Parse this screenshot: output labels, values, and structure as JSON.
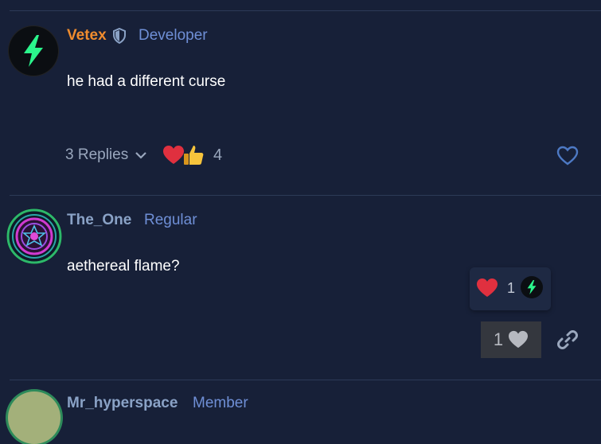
{
  "posts": [
    {
      "username": "Vetex",
      "badge": "Developer",
      "text": "he had a different curse",
      "replies_label": "3 Replies",
      "reaction_count": "4"
    },
    {
      "username": "The_One",
      "badge": "Regular",
      "text": "aethereal flame?",
      "popup_reaction_count": "1",
      "like_count": "1"
    },
    {
      "username": "Mr_hyperspace",
      "badge": "Member"
    }
  ],
  "colors": {
    "background": "#172038",
    "developer_name": "#f08c2e",
    "member_name": "#8aa2c6",
    "badge": "#6f8fd6",
    "heart_red": "#e0303f",
    "bolt_green": "#2bf58c"
  },
  "icons": [
    "shield-icon",
    "chevron-down-icon",
    "heart-icon",
    "thumbs-up-icon",
    "heart-outline-icon",
    "link-icon",
    "bolt-icon"
  ]
}
